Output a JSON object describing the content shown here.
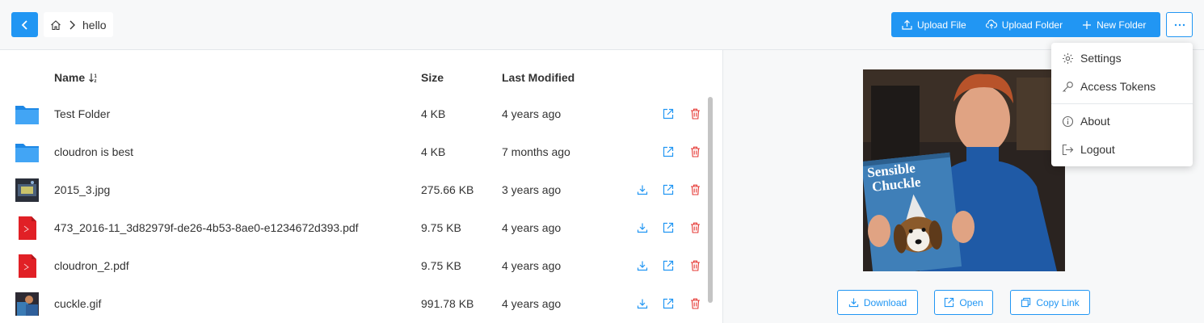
{
  "breadcrumb": {
    "folder": "hello"
  },
  "toolbar": {
    "upload_file": "Upload File",
    "upload_folder": "Upload Folder",
    "new_folder": "New Folder"
  },
  "columns": {
    "name": "Name",
    "size": "Size",
    "modified": "Last Modified"
  },
  "files": [
    {
      "name": "Test Folder",
      "size": "4 KB",
      "modified": "4 years ago",
      "kind": "folder"
    },
    {
      "name": "cloudron is best",
      "size": "4 KB",
      "modified": "7 months ago",
      "kind": "folder"
    },
    {
      "name": "2015_3.jpg",
      "size": "275.66 KB",
      "modified": "3 years ago",
      "kind": "image"
    },
    {
      "name": "473_2016-11_3d82979f-de26-4b53-8ae0-e1234672d393.pdf",
      "size": "9.75 KB",
      "modified": "4 years ago",
      "kind": "pdf"
    },
    {
      "name": "cloudron_2.pdf",
      "size": "9.75 KB",
      "modified": "4 years ago",
      "kind": "pdf"
    },
    {
      "name": "cuckle.gif",
      "size": "991.78 KB",
      "modified": "4 years ago",
      "kind": "image"
    }
  ],
  "preview": {
    "magazine_title": "Sensible Chuckle",
    "download": "Download",
    "open": "Open",
    "copy_link": "Copy Link"
  },
  "menu": {
    "settings": "Settings",
    "access_tokens": "Access Tokens",
    "about": "About",
    "logout": "Logout"
  },
  "colors": {
    "accent": "#2196f3",
    "danger": "#e53935",
    "folder": "#1e88e5",
    "pdf": "#e12026"
  }
}
